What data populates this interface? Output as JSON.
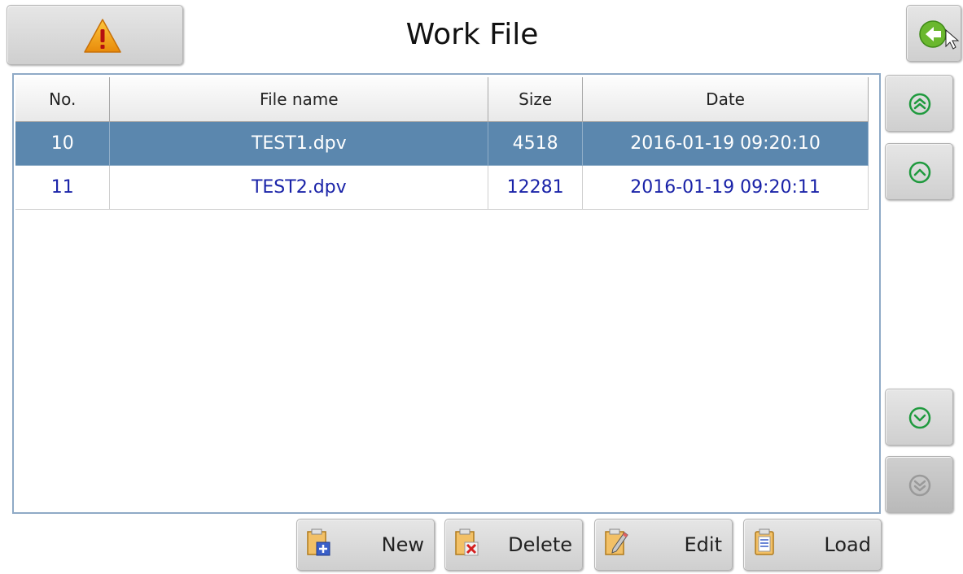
{
  "header": {
    "title": "Work File"
  },
  "table": {
    "columns": [
      "No.",
      "File name",
      "Size",
      "Date"
    ],
    "rows": [
      {
        "no": "10",
        "file_name": "TEST1.dpv",
        "size": "4518",
        "date": "2016-01-19 09:20:10",
        "selected": true
      },
      {
        "no": "11",
        "file_name": "TEST2.dpv",
        "size": "12281",
        "date": "2016-01-19 09:20:11",
        "selected": false
      }
    ]
  },
  "actions": {
    "new_label": "New",
    "delete_label": "Delete",
    "edit_label": "Edit",
    "load_label": "Load"
  },
  "icons": {
    "alarm": "warning-triangle-icon",
    "back": "back-arrow-icon",
    "scroll_top": "double-chevron-up-icon",
    "scroll_up": "chevron-up-icon",
    "scroll_down": "chevron-down-icon",
    "scroll_bottom": "double-chevron-down-icon"
  },
  "colors": {
    "selected_row": "#5b87ae",
    "row_text": "#1a23a8",
    "scroll_icon": "#1f9a3e",
    "warning": "#f0a020",
    "back_icon": "#6ab82e"
  }
}
